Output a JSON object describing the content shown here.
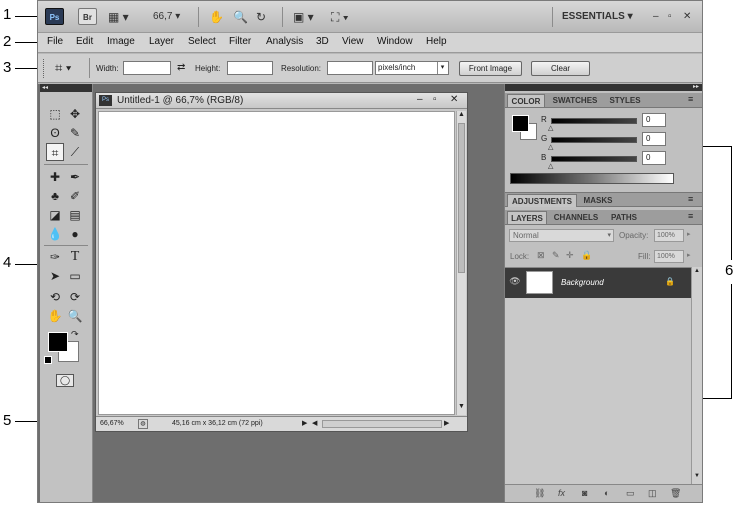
{
  "callouts": [
    "1",
    "2",
    "3",
    "4",
    "5",
    "6"
  ],
  "app_bar": {
    "ps_logo": "Ps",
    "br_logo": "Br",
    "zoom": "66,7",
    "workspace": "ESSENTIALS"
  },
  "menu": [
    "File",
    "Edit",
    "Image",
    "Layer",
    "Select",
    "Filter",
    "Analysis",
    "3D",
    "View",
    "Window",
    "Help"
  ],
  "options_bar": {
    "width_label": "Width:",
    "height_label": "Height:",
    "resolution_label": "Resolution:",
    "units": "pixels/inch",
    "front_image": "Front Image",
    "clear": "Clear"
  },
  "document": {
    "title": "Untitled-1 @ 66,7% (RGB/8)",
    "status_zoom": "66,67%",
    "status_info": "45,16 cm x 36,12 cm (72 ppi)"
  },
  "color_panel": {
    "tabs": [
      "COLOR",
      "SWATCHES",
      "STYLES"
    ],
    "channels": [
      {
        "label": "R",
        "value": "0"
      },
      {
        "label": "G",
        "value": "0"
      },
      {
        "label": "B",
        "value": "0"
      }
    ]
  },
  "adjustments_panel": {
    "tabs": [
      "ADJUSTMENTS",
      "MASKS"
    ]
  },
  "layers_panel": {
    "tabs": [
      "LAYERS",
      "CHANNELS",
      "PATHS"
    ],
    "blend_mode": "Normal",
    "opacity_label": "Opacity:",
    "opacity": "100%",
    "lock_label": "Lock:",
    "fill_label": "Fill:",
    "fill": "100%",
    "layer_name": "Background"
  }
}
